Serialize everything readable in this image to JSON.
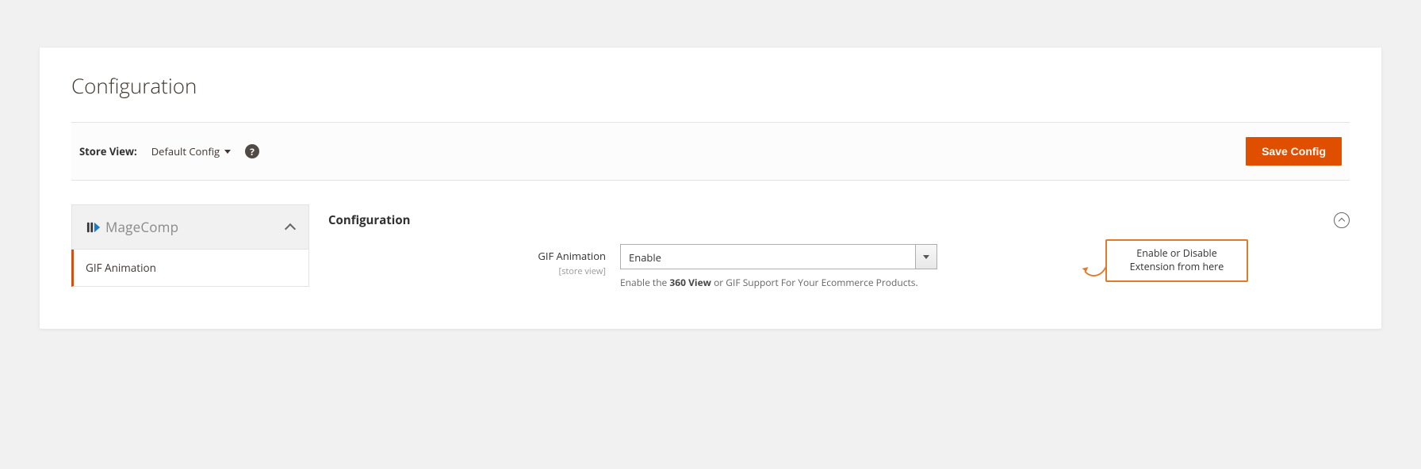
{
  "page": {
    "title": "Configuration"
  },
  "toolbar": {
    "store_view_label": "Store View:",
    "store_view_value": "Default Config",
    "help_glyph": "?",
    "save_label": "Save Config"
  },
  "sidebar": {
    "brand": "MageComp",
    "items": [
      {
        "label": "GIF Animation",
        "active": true
      }
    ]
  },
  "section": {
    "title": "Configuration",
    "fields": {
      "gif_animation": {
        "label": "GIF Animation",
        "scope": "[store view]",
        "value": "Enable",
        "note_prefix": "Enable the ",
        "note_strong": "360 View",
        "note_suffix": " or GIF Support For Your Ecommerce Products."
      }
    }
  },
  "callout": {
    "line1": "Enable or Disable",
    "line2": "Extension from here"
  },
  "colors": {
    "accent": "#e04f00",
    "callout_border": "#e07b2e"
  }
}
